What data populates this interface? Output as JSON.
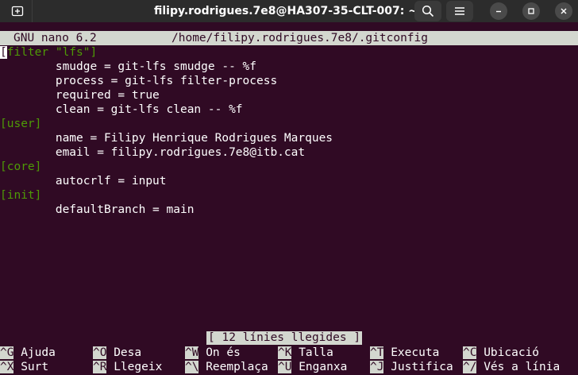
{
  "window": {
    "title": "filipy.rodrigues.7e8@HA307-35-CLT-007: ~",
    "icons": {
      "new_tab": "new-tab-icon",
      "search": "search-icon",
      "menu": "hamburger-menu-icon",
      "minimize": "minimize-icon",
      "maximize": "maximize-icon",
      "close": "close-icon"
    }
  },
  "nano": {
    "version": "GNU nano 6.2",
    "file_path": "/home/filipy.rodrigues.7e8/.gitconfig",
    "status_message": "[ 12 línies llegides ]"
  },
  "file_lines": [
    {
      "cursor": "[",
      "text": "filter \"lfs\"]",
      "section": true
    },
    {
      "text": "        smudge = git-lfs smudge -- %f",
      "section": false
    },
    {
      "text": "        process = git-lfs filter-process",
      "section": false
    },
    {
      "text": "        required = true",
      "section": false
    },
    {
      "text": "        clean = git-lfs clean -- %f",
      "section": false
    },
    {
      "text": "[user]",
      "section": true
    },
    {
      "text": "        name = Filipy Henrique Rodrigues Marques",
      "section": false
    },
    {
      "text": "        email = filipy.rodrigues.7e8@itb.cat",
      "section": false
    },
    {
      "text": "[core]",
      "section": true
    },
    {
      "text": "        autocrlf = input",
      "section": false
    },
    {
      "text": "[init]",
      "section": true
    },
    {
      "text": "        defaultBranch = main",
      "section": false
    }
  ],
  "shortcuts": [
    {
      "key": "^G",
      "label": "Ajuda"
    },
    {
      "key": "^O",
      "label": "Desa"
    },
    {
      "key": "^W",
      "label": "On és"
    },
    {
      "key": "^K",
      "label": "Talla"
    },
    {
      "key": "^T",
      "label": "Executa"
    },
    {
      "key": "^C",
      "label": "Ubicació"
    },
    {
      "key": "^X",
      "label": "Surt"
    },
    {
      "key": "^R",
      "label": "Llegeix"
    },
    {
      "key": "^\\",
      "label": "Reemplaça"
    },
    {
      "key": "^U",
      "label": "Enganxa"
    },
    {
      "key": "^J",
      "label": "Justifica"
    },
    {
      "key": "^/",
      "label": "Vés a línia"
    }
  ],
  "colors": {
    "terminal_bg": "#300a24",
    "section_green": "#4e9a06",
    "inverse_bg": "#d3d7cf"
  }
}
